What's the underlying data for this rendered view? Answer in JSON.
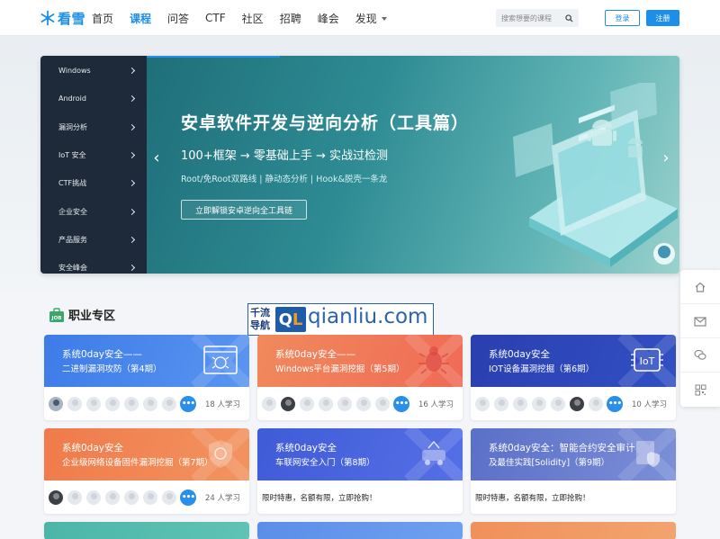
{
  "header": {
    "logo_text": "看雪",
    "nav": [
      {
        "label": "首页",
        "active": false
      },
      {
        "label": "课程",
        "active": true
      },
      {
        "label": "问答",
        "active": false
      },
      {
        "label": "CTF",
        "active": false
      },
      {
        "label": "社区",
        "active": false
      },
      {
        "label": "招聘",
        "active": false
      },
      {
        "label": "峰会",
        "active": false
      },
      {
        "label": "发现",
        "active": false,
        "dropdown": true
      }
    ],
    "search_placeholder": "搜索想要的课程",
    "login_label": "登录",
    "register_label": "注册"
  },
  "banner": {
    "menu": [
      "Windows",
      "Android",
      "漏洞分析",
      "IoT 安全",
      "CTF挑战",
      "企业安全",
      "产品服务",
      "安全峰会"
    ],
    "title": "安卓软件开发与逆向分析（工具篇）",
    "subtitle": "100+框架 → 零基础上手 → 实战过检测",
    "tags": "Root/免Root双路线 | 静动态分析 | Hook&脱壳一条龙",
    "cta": "立即解锁安卓逆向全工具链",
    "prev_icon": "‹",
    "next_icon": "›"
  },
  "section": {
    "title": "职业专区",
    "ad": {
      "cn": "千流导航",
      "badge_q": "Q",
      "badge_l": "L",
      "url": "qianliu.com"
    }
  },
  "cards": [
    {
      "line1": "系统0day安全——",
      "line2": "二进制漏洞攻防（第4期）",
      "learners": "18 人学习",
      "promo": "",
      "grad": "linear-gradient(110deg,#3d7be8,#5a95f0)",
      "icon": "bug-window-icon"
    },
    {
      "line1": "系统0day安全——",
      "line2": "Windows平台漏洞挖掘（第5期）",
      "learners": "16 人学习",
      "promo": "",
      "grad": "linear-gradient(110deg,#f08a5d,#f06a55)",
      "icon": "bug-icon"
    },
    {
      "line1": "系统0day安全",
      "line2": "IOT设备漏洞挖掘（第6期）",
      "learners": "10 人学习",
      "promo": "",
      "grad": "linear-gradient(110deg,#2a3fb0,#3150c4)",
      "icon": "iot-icon"
    },
    {
      "line1": "系统0day安全",
      "line2": "企业级网络设备固件漏洞挖掘（第7期）",
      "learners": "24 人学习",
      "promo": "",
      "grad": "linear-gradient(110deg,#f07a4a,#f29460)",
      "icon": "shield-icon"
    },
    {
      "line1": "系统0day安全",
      "line2": "车联网安全入门（第8期）",
      "learners": "",
      "promo": "限时特惠，名额有限，立即抢购！",
      "grad": "linear-gradient(110deg,#3f5bd6,#5570e6)",
      "icon": "car-icon"
    },
    {
      "line1": "系统0day安全：智能合约安全审计",
      "line2": "及最佳实践[Solidity]（第9期）",
      "learners": "",
      "promo": "限时特惠，名额有限，立即抢购！",
      "grad": "linear-gradient(110deg,#5a6fc7,#7c8fd8)",
      "icon": "doc-shield-icon"
    }
  ],
  "bottom_cards": [
    {
      "grad": "linear-gradient(110deg,#4bb6a8,#5fc3b5)"
    },
    {
      "grad": "linear-gradient(110deg,#5a8ee8,#6fa0f0)"
    },
    {
      "grad": "linear-gradient(110deg,#f0905a,#f2a46e)"
    }
  ],
  "float_bar": [
    "home-icon",
    "mail-icon",
    "wechat-icon",
    "qrcode-icon"
  ]
}
